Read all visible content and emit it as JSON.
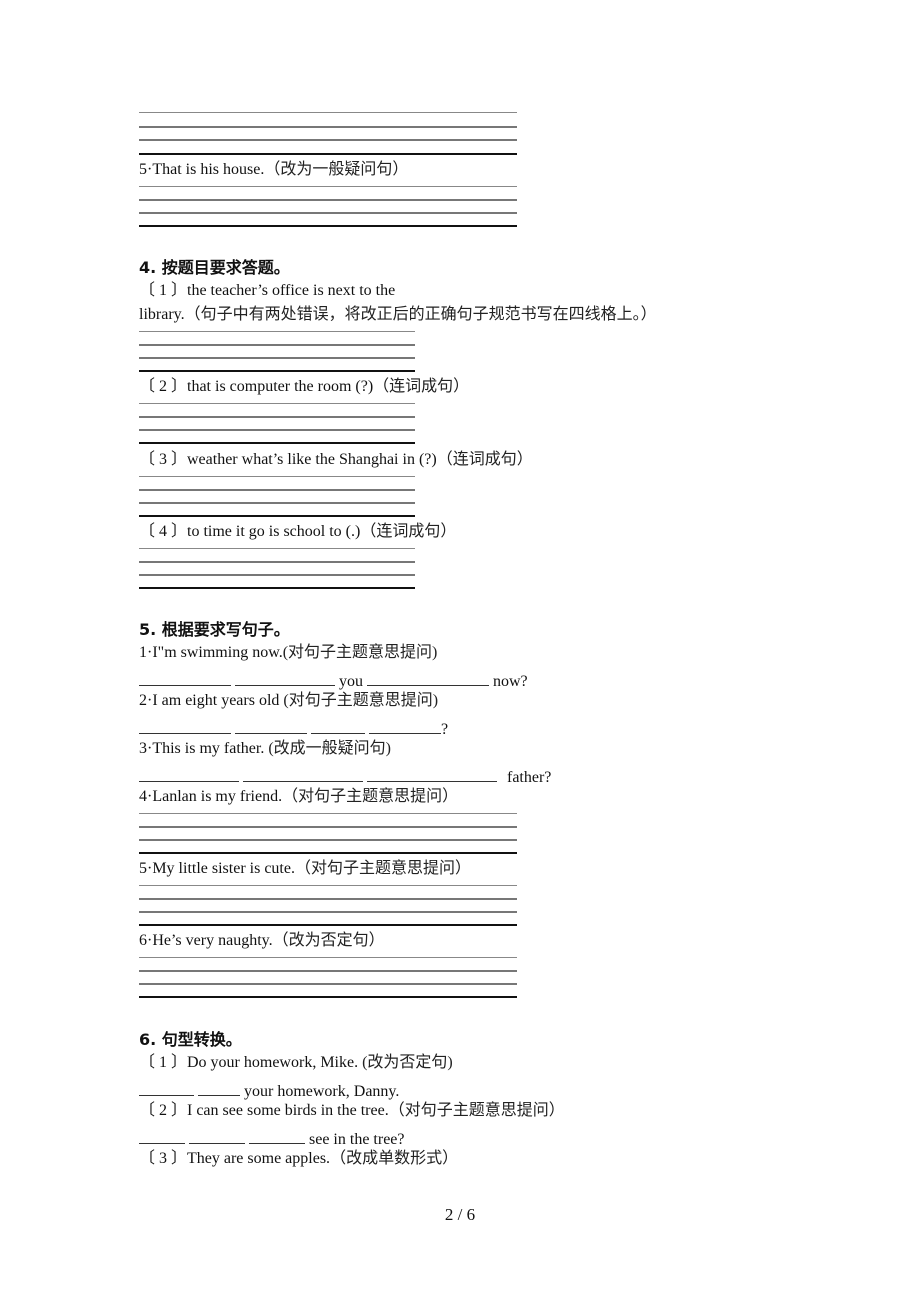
{
  "top": {
    "q5": "5·That is his house.",
    "q5_note": "（改为一般疑问句）"
  },
  "section4": {
    "title": "4.  按题目要求答题。",
    "items": [
      {
        "label": "〔 1 〕the teacher’s office is next to the",
        "cont": "library.",
        "note": "（句子中有两处错误，将改正后的正确句子规范书写在四线格上。）"
      },
      {
        "label": "〔 2 〕that is computer the room (?)",
        "note": "（连词成句）"
      },
      {
        "label": "〔 3 〕weather what’s like the Shanghai in (?)",
        "note": "（连词成句）"
      },
      {
        "label": "〔 4 〕to time it go is school to (.)",
        "note": "（连词成句）"
      }
    ]
  },
  "section5": {
    "title": "5.  根据要求写句子。",
    "items": [
      {
        "label": "1·I\"m swimming now.",
        "note": "(对句子主题意思提问)",
        "answer_words": [
          "you",
          "now?"
        ]
      },
      {
        "label": "2·I am eight years old",
        "note": "(对句子主题意思提问)",
        "answer_words": [
          "?"
        ]
      },
      {
        "label": "3·This is my father.",
        "note": " (改成一般疑问句)",
        "answer_words": [
          "father?"
        ]
      },
      {
        "label": "4·Lanlan is my friend.",
        "note": "（对句子主题意思提问）"
      },
      {
        "label": "5·My little sister is cute.",
        "note": "（对句子主题意思提问）"
      },
      {
        "label": "6·He’s very naughty.",
        "note": "（改为否定句）"
      }
    ]
  },
  "section6": {
    "title": "6.  句型转换。",
    "items": [
      {
        "label": "〔 1 〕Do your homework, Mike.",
        "note": " (改为否定句)",
        "answer_text": "your homework, Danny."
      },
      {
        "label": "〔 2 〕I can see some birds in the tree.",
        "note": "（对句子主题意思提问）",
        "answer_text": "see in the tree?"
      },
      {
        "label": "〔 3 〕They are some apples.",
        "note": "（改成单数形式）"
      }
    ]
  },
  "footer": {
    "page": "2 / 6"
  }
}
